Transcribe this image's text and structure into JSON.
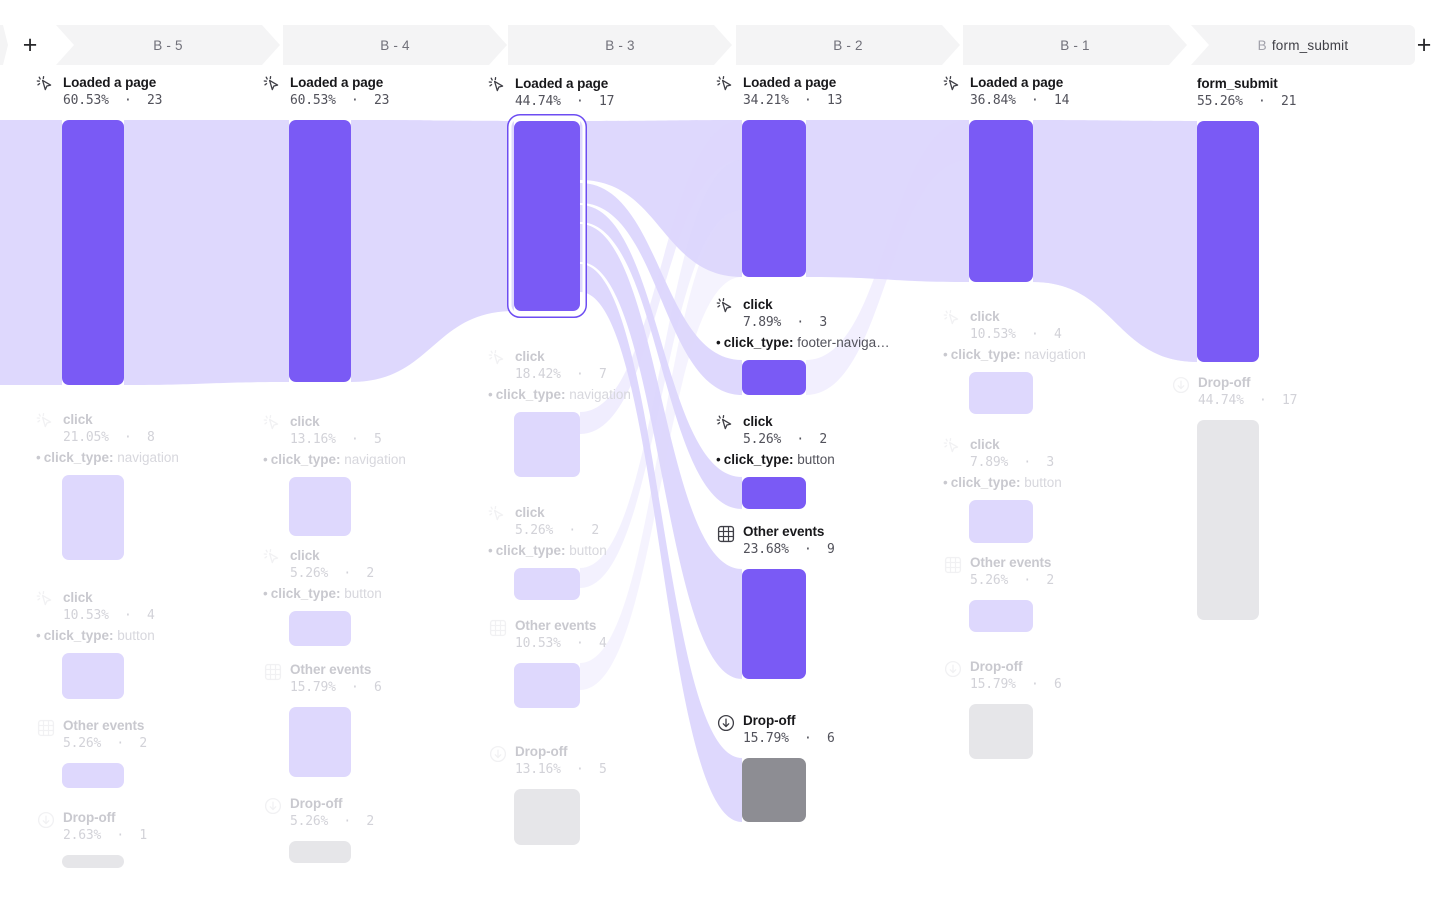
{
  "app": {
    "add_step_label": "+",
    "add_step_right_label": "+"
  },
  "colors": {
    "node_active": "#7a5af5",
    "node_link": "#ded8fd",
    "node_dropoff": "#e6e6e9",
    "node_dropoff_active": "#8d8d93",
    "selected_ring": "#6d4df2",
    "tab_bg": "#f4f4f5"
  },
  "tabs": [
    {
      "prefix": "B",
      "label": "- 5",
      "full": "B - 5",
      "selected": false
    },
    {
      "prefix": "B",
      "label": "- 4",
      "full": "B - 4",
      "selected": false
    },
    {
      "prefix": "B",
      "label": "- 3",
      "full": "B - 3",
      "selected": false
    },
    {
      "prefix": "B",
      "label": "- 2",
      "full": "B - 2",
      "selected": false
    },
    {
      "prefix": "B",
      "label": "- 1",
      "full": "B - 1",
      "selected": false
    },
    {
      "prefix": "B",
      "label": "form_submit",
      "full": "B form_submit",
      "selected": true
    }
  ],
  "chart_data": {
    "type": "sankey",
    "title": "Event path flow",
    "steps": [
      {
        "step": "B - 5",
        "nodes": [
          {
            "icon": "cursor-click-icon",
            "title": "Loaded a page",
            "percent": "60.53%",
            "count": "23",
            "separator": "·",
            "property": null,
            "kind": "active",
            "dim": false
          },
          {
            "icon": "cursor-click-icon",
            "title": "click",
            "percent": "21.05%",
            "count": "8",
            "separator": "·",
            "property": {
              "key": "click_type",
              "value": "navigation"
            },
            "kind": "link",
            "dim": true
          },
          {
            "icon": "cursor-click-icon",
            "title": "click",
            "percent": "10.53%",
            "count": "4",
            "separator": "·",
            "property": {
              "key": "click_type",
              "value": "button"
            },
            "kind": "link",
            "dim": true
          },
          {
            "icon": "grid-icon",
            "title": "Other events",
            "percent": "5.26%",
            "count": "2",
            "separator": "·",
            "property": null,
            "kind": "link",
            "dim": true
          },
          {
            "icon": "dropoff-icon",
            "title": "Drop-off",
            "percent": "2.63%",
            "count": "1",
            "separator": "·",
            "property": null,
            "kind": "dropoff",
            "dim": true
          }
        ]
      },
      {
        "step": "B - 4",
        "nodes": [
          {
            "icon": "cursor-click-icon",
            "title": "Loaded a page",
            "percent": "60.53%",
            "count": "23",
            "separator": "·",
            "property": null,
            "kind": "active",
            "dim": false
          },
          {
            "icon": "cursor-click-icon",
            "title": "click",
            "percent": "13.16%",
            "count": "5",
            "separator": "·",
            "property": {
              "key": "click_type",
              "value": "navigation"
            },
            "kind": "link",
            "dim": true
          },
          {
            "icon": "cursor-click-icon",
            "title": "click",
            "percent": "5.26%",
            "count": "2",
            "separator": "·",
            "property": {
              "key": "click_type",
              "value": "button"
            },
            "kind": "link",
            "dim": true
          },
          {
            "icon": "grid-icon",
            "title": "Other events",
            "percent": "15.79%",
            "count": "6",
            "separator": "·",
            "property": null,
            "kind": "link",
            "dim": true
          },
          {
            "icon": "dropoff-icon",
            "title": "Drop-off",
            "percent": "5.26%",
            "count": "2",
            "separator": "·",
            "property": null,
            "kind": "dropoff",
            "dim": true
          }
        ]
      },
      {
        "step": "B - 3",
        "nodes": [
          {
            "icon": "cursor-click-icon",
            "title": "Loaded a page",
            "percent": "44.74%",
            "count": "17",
            "separator": "·",
            "property": null,
            "kind": "active",
            "dim": false,
            "selected": true
          },
          {
            "icon": "cursor-click-icon",
            "title": "click",
            "percent": "18.42%",
            "count": "7",
            "separator": "·",
            "property": {
              "key": "click_type",
              "value": "navigation"
            },
            "kind": "link",
            "dim": true
          },
          {
            "icon": "cursor-click-icon",
            "title": "click",
            "percent": "5.26%",
            "count": "2",
            "separator": "·",
            "property": {
              "key": "click_type",
              "value": "button"
            },
            "kind": "link",
            "dim": true
          },
          {
            "icon": "grid-icon",
            "title": "Other events",
            "percent": "10.53%",
            "count": "4",
            "separator": "·",
            "property": null,
            "kind": "link",
            "dim": true
          },
          {
            "icon": "dropoff-icon",
            "title": "Drop-off",
            "percent": "13.16%",
            "count": "5",
            "separator": "·",
            "property": null,
            "kind": "dropoff",
            "dim": true
          }
        ]
      },
      {
        "step": "B - 2",
        "nodes": [
          {
            "icon": "cursor-click-icon",
            "title": "Loaded a page",
            "percent": "34.21%",
            "count": "13",
            "separator": "·",
            "property": null,
            "kind": "active",
            "dim": false
          },
          {
            "icon": "cursor-click-icon",
            "title": "click",
            "percent": "7.89%",
            "count": "3",
            "separator": "·",
            "property": {
              "key": "click_type",
              "value": "footer-naviga…"
            },
            "kind": "active",
            "dim": false
          },
          {
            "icon": "cursor-click-icon",
            "title": "click",
            "percent": "5.26%",
            "count": "2",
            "separator": "·",
            "property": {
              "key": "click_type",
              "value": "button"
            },
            "kind": "active",
            "dim": false
          },
          {
            "icon": "grid-icon",
            "title": "Other events",
            "percent": "23.68%",
            "count": "9",
            "separator": "·",
            "property": null,
            "kind": "active",
            "dim": false
          },
          {
            "icon": "dropoff-icon",
            "title": "Drop-off",
            "percent": "15.79%",
            "count": "6",
            "separator": "·",
            "property": null,
            "kind": "dropoff-active",
            "dim": false
          }
        ]
      },
      {
        "step": "B - 1",
        "nodes": [
          {
            "icon": "cursor-click-icon",
            "title": "Loaded a page",
            "percent": "36.84%",
            "count": "14",
            "separator": "·",
            "property": null,
            "kind": "active",
            "dim": false
          },
          {
            "icon": "cursor-click-icon",
            "title": "click",
            "percent": "10.53%",
            "count": "4",
            "separator": "·",
            "property": {
              "key": "click_type",
              "value": "navigation"
            },
            "kind": "link",
            "dim": true
          },
          {
            "icon": "cursor-click-icon",
            "title": "click",
            "percent": "7.89%",
            "count": "3",
            "separator": "·",
            "property": {
              "key": "click_type",
              "value": "button"
            },
            "kind": "link",
            "dim": true
          },
          {
            "icon": "grid-icon",
            "title": "Other events",
            "percent": "5.26%",
            "count": "2",
            "separator": "·",
            "property": null,
            "kind": "link",
            "dim": true
          },
          {
            "icon": "dropoff-icon",
            "title": "Drop-off",
            "percent": "15.79%",
            "count": "6",
            "separator": "·",
            "property": null,
            "kind": "dropoff",
            "dim": true
          }
        ]
      },
      {
        "step": "B form_submit",
        "nodes": [
          {
            "icon": null,
            "title": "form_submit",
            "percent": "55.26%",
            "count": "21",
            "separator": "·",
            "property": null,
            "kind": "active",
            "dim": false
          },
          {
            "icon": "dropoff-icon",
            "title": "Drop-off",
            "percent": "44.74%",
            "count": "17",
            "separator": "·",
            "property": null,
            "kind": "dropoff",
            "dim": true
          }
        ]
      }
    ]
  }
}
